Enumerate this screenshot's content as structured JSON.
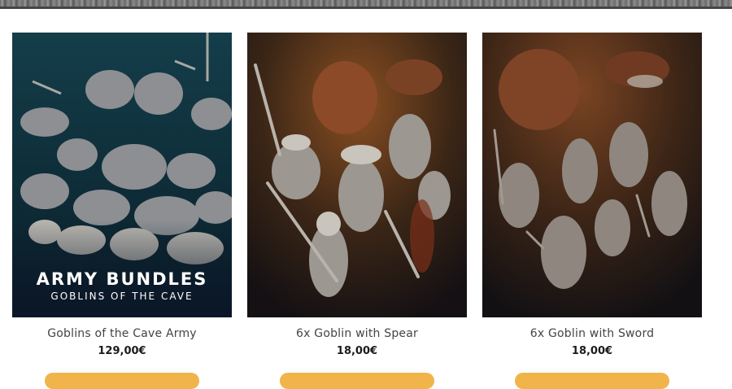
{
  "products": [
    {
      "title": "Goblins of the Cave Army",
      "price": "129,00€",
      "overlay_title": "ARMY BUNDLES",
      "overlay_subtitle": "GOBLINS OF THE CAVE",
      "image": "goblin-army-miniatures-photo"
    },
    {
      "title": "6x Goblin with Spear",
      "price": "18,00€",
      "image": "goblin-spear-miniatures-photo"
    },
    {
      "title": "6x Goblin with Sword",
      "price": "18,00€",
      "image": "goblin-sword-miniatures-photo"
    }
  ],
  "colors": {
    "button": "#f0b44a",
    "title_text": "#444444",
    "price_text": "#1b1b1b",
    "card1_background": "#123a45",
    "card2_background": "#3a2414",
    "card3_background": "#3b2617"
  }
}
